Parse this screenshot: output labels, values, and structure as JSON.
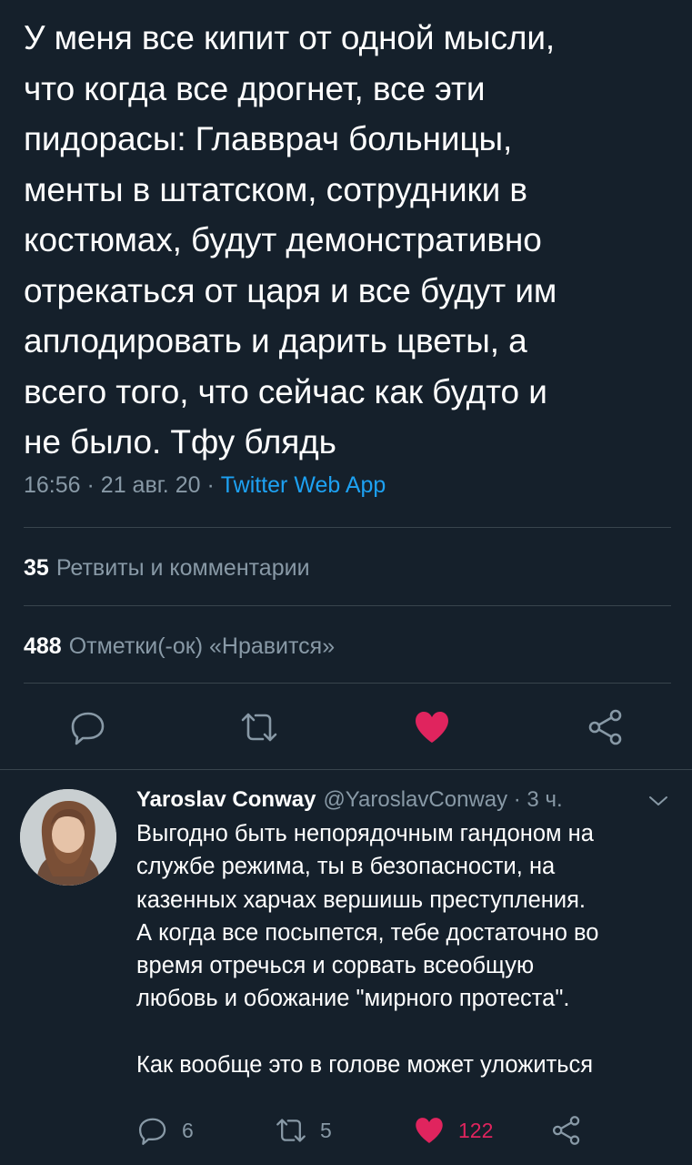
{
  "tweet": {
    "lines": [
      "У меня все кипит от одной мысли,",
      "что когда все дрогнет, все эти",
      "пидорасы: Главврач больницы,",
      "менты в штатском, сотрудники в",
      "костюмах, будут демонстративно",
      "отрекаться от царя и все будут им",
      "аплодировать и дарить цветы, а",
      "всего того, что сейчас как будто и",
      "не было. Тфу блядь"
    ],
    "time": "16:56",
    "date": "21 авг. 20",
    "separator": "·",
    "source": "Twitter Web App"
  },
  "stats": {
    "retweets_count": "35",
    "retweets_label": "Ретвиты и комментарии",
    "likes_count": "488",
    "likes_label": "Отметки(-ок) «Нравится»"
  },
  "actions": {
    "icons": [
      "reply-icon",
      "retweet-icon",
      "like-icon",
      "share-icon"
    ],
    "liked": true
  },
  "reply": {
    "name": "Yaroslav Conway",
    "handle": "@YaroslavConway · 3 ч.",
    "lines": [
      "Выгодно быть непорядочным гандоном на",
      "службе режима, ты в безопасности, на",
      "казенных харчах вершишь преступления.",
      "А когда все посыпется, тебе достаточно во",
      "время отречься и сорвать всеобщую",
      "любовь и обожание \"мирного протеста\".",
      "",
      "Как вообще это в голове может уложиться"
    ],
    "reply_count": "6",
    "retweet_count": "5",
    "like_count": "122",
    "liked": true
  },
  "colors": {
    "background": "#15202b",
    "text": "#ffffff",
    "secondary_text": "#8899a6",
    "link": "#1da1f2",
    "like": "#e0245e",
    "divider": "#38444d"
  }
}
